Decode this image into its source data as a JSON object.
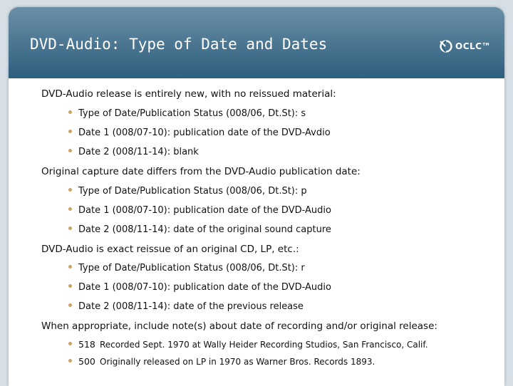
{
  "slide": {
    "title": "DVD-Audio:  Type of Date and Dates",
    "logo_text": "OCLC",
    "logo_tm": "TM"
  },
  "sections": [
    {
      "heading": "DVD-Audio release is entirely new, with no reissued material:",
      "bullets": [
        "Type of Date/Publication Status (008/06, Dt.St):  s",
        "Date 1 (008/07-10):  publication date of the DVD-Avdio",
        "Date 2 (008/11-14):  blank"
      ]
    },
    {
      "heading": "Original capture date differs from the DVD-Audio publication date:",
      "bullets": [
        "Type of Date/Publication Status (008/06, Dt.St):  p",
        "Date 1 (008/07-10):  publication date of the DVD-Audio",
        "Date 2 (008/11-14):  date of the original sound capture"
      ]
    },
    {
      "heading": "DVD-Audio is exact reissue of an original CD, LP, etc.:",
      "bullets": [
        "Type of Date/Publication Status (008/06, Dt.St):  r",
        "Date 1 (008/07-10):  publication date of the DVD-Audio",
        "Date 2 (008/11-14):  date of the previous release"
      ]
    },
    {
      "heading": "When appropriate, include note(s) about date of recording and/or original release:",
      "notes": [
        {
          "code": "518",
          "text": "Recorded Sept. 1970 at Wally Heider Recording Studios, San Francisco, Calif."
        },
        {
          "code": "500",
          "text": "Originally released on LP in 1970 as Warner Bros. Records 1893."
        }
      ]
    }
  ],
  "colors": {
    "header_top": "#6a8fa6",
    "header_bottom": "#2e5f7e",
    "bullet": "#c8a366"
  }
}
